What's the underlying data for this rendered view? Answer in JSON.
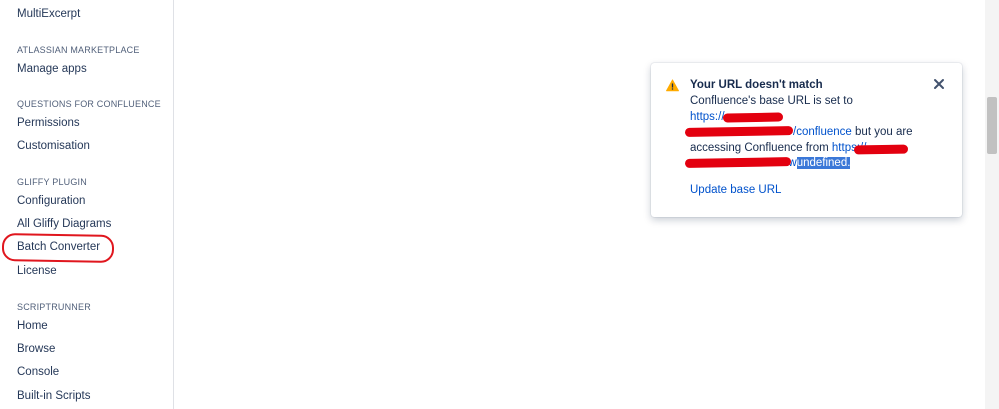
{
  "sidebar": {
    "top_item": "MultiExcerpt",
    "sections": [
      {
        "heading": "ATLASSIAN MARKETPLACE",
        "items": [
          "Manage apps"
        ]
      },
      {
        "heading": "QUESTIONS FOR CONFLUENCE",
        "items": [
          "Permissions",
          "Customisation"
        ]
      },
      {
        "heading": "GLIFFY PLUGIN",
        "items": [
          "Configuration",
          "All Gliffy Diagrams",
          "Batch Converter",
          "License"
        ]
      },
      {
        "heading": "SCRIPTRUNNER",
        "items": [
          "Home",
          "Browse",
          "Console",
          "Built-in Scripts"
        ]
      }
    ]
  },
  "flag": {
    "title": "Your URL doesn't match",
    "line1": "Confluence's base URL is set to",
    "line2_link": "https://",
    "line3_link": "/confluence",
    "line3_rest": " but you are",
    "line4_text": "accessing Confluence from ",
    "line4_link": "https://",
    "line5_prefix": "nw",
    "line5_selected": "undefined.",
    "action_label": "Update base URL"
  },
  "colors": {
    "link": "#0052cc",
    "warning": "#ffab00",
    "annotation": "#e0161e",
    "redaction": "#e3000f"
  }
}
